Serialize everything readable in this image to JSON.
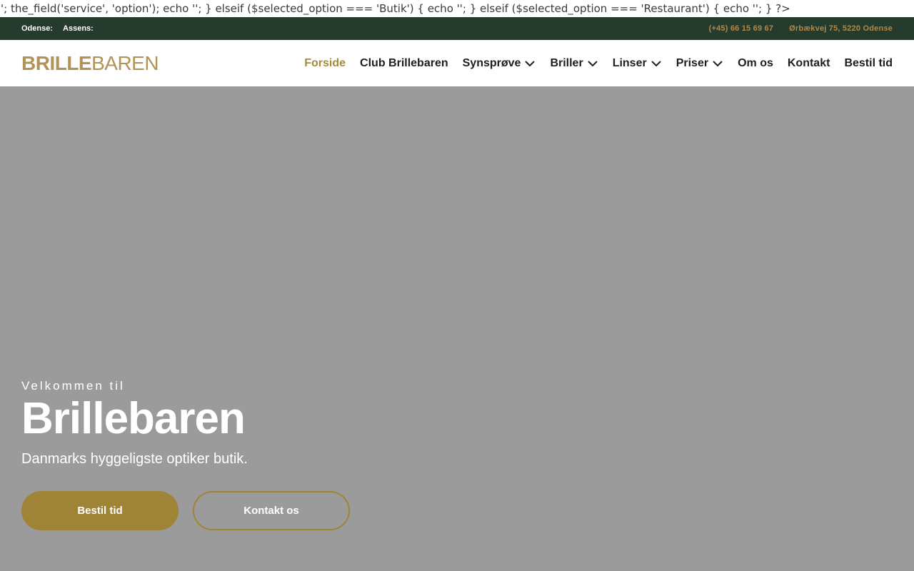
{
  "php_leak": "'; the_field('service', 'option'); echo ''; } elseif ($selected_option === 'Butik') { echo ''; } elseif ($selected_option === 'Restaurant') { echo ''; } ?>",
  "topbar": {
    "locations": [
      "Odense:",
      "Assens:"
    ],
    "phone": "(+45) 66 15 69 67",
    "address": "Ørbækvej 75, 5220 Odense"
  },
  "logo": {
    "bold": "BRILLE",
    "light": "BAREN"
  },
  "nav": {
    "items": [
      {
        "label": "Forside",
        "active": true,
        "dropdown": false
      },
      {
        "label": "Club Brillebaren",
        "active": false,
        "dropdown": false
      },
      {
        "label": "Synsprøve",
        "active": false,
        "dropdown": true
      },
      {
        "label": "Briller",
        "active": false,
        "dropdown": true
      },
      {
        "label": "Linser",
        "active": false,
        "dropdown": true
      },
      {
        "label": "Priser",
        "active": false,
        "dropdown": true
      },
      {
        "label": "Om os",
        "active": false,
        "dropdown": false
      },
      {
        "label": "Kontakt",
        "active": false,
        "dropdown": false
      },
      {
        "label": "Bestil tid",
        "active": false,
        "dropdown": false
      }
    ]
  },
  "hero": {
    "eyebrow": "Velkommen til",
    "title": "Brillebaren",
    "subtitle": "Danmarks hyggeligste optiker butik.",
    "primary_button": "Bestil tid",
    "secondary_button": "Kontakt os"
  },
  "colors": {
    "topbar_bg": "#243b2d",
    "accent_gold": "#9f8437",
    "logo_gold": "#b19257",
    "hero_bg": "#9b9b9b"
  }
}
